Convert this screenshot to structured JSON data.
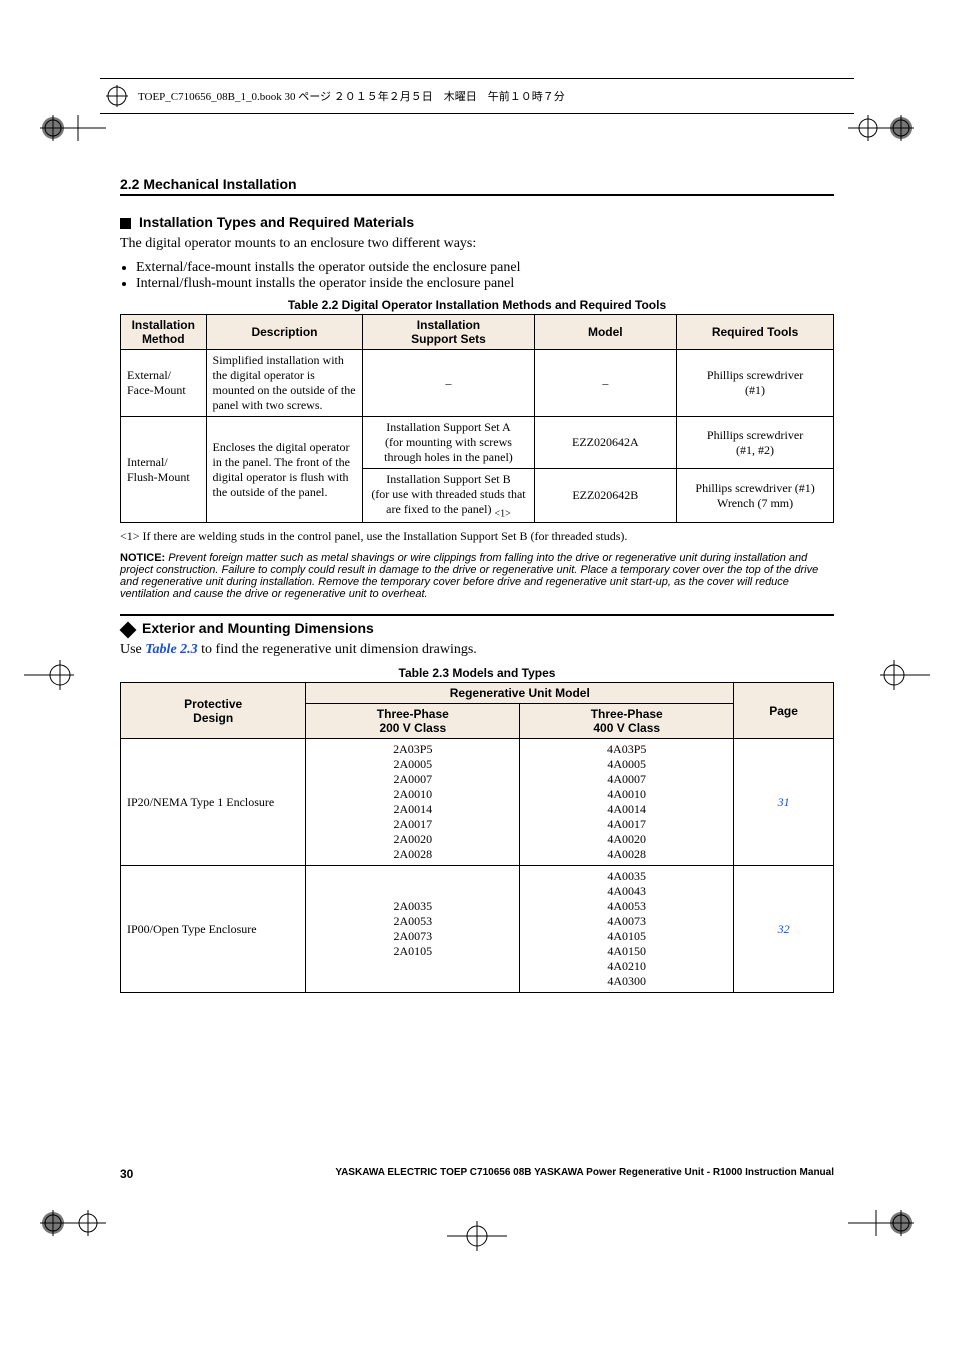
{
  "print_header": "TOEP_C710656_08B_1_0.book  30 ページ  ２０１５年２月５日　木曜日　午前１０時７分",
  "section_header": "2.2  Mechanical Installation",
  "subheading1": "Installation Types and Required Materials",
  "para1": "The digital operator mounts to an enclosure two different ways:",
  "bullet1": "External/face-mount installs the operator outside the enclosure panel",
  "bullet2": "Internal/flush-mount installs the operator inside the enclosure panel",
  "table22_caption": "Table 2.2  Digital Operator Installation Methods and Required Tools",
  "t22": {
    "h1": "Installation Method",
    "h2": "Description",
    "h3": "Installation\nSupport Sets",
    "h4": "Model",
    "h5": "Required Tools",
    "r1c1": "External/\nFace-Mount",
    "r1c2": "Simplified installation with the digital operator is mounted on the outside of the panel with two screws.",
    "r1c3": "–",
    "r1c4": "–",
    "r1c5": "Phillips screwdriver\n(#1)",
    "r2c1": "Internal/\nFlush-Mount",
    "r2c2": "Encloses the digital operator in the panel. The front of the digital operator is flush with the outside of the panel.",
    "r2ac3": "Installation Support Set A\n(for mounting with screws through holes in the panel)",
    "r2ac4": "EZZ020642A",
    "r2ac5": "Phillips screwdriver\n(#1, #2)",
    "r2bc3_a": "Installation Support Set B\n(for use with threaded studs that are fixed to the panel) ",
    "r2bc3_ref": "<1>",
    "r2bc4": "EZZ020642B",
    "r2bc5": "Phillips screwdriver (#1)\nWrench (7 mm)"
  },
  "footnote1": "<1>  If there are welding studs in the control panel, use the Installation Support Set B (for threaded studs).",
  "notice_label": "NOTICE:",
  "notice_text": " Prevent foreign matter such as metal shavings or wire clippings from falling into the drive or regenerative unit during installation and project construction. Failure to comply could result in damage to the drive or regenerative unit. Place a temporary cover over the top of the drive and regenerative unit during installation. Remove the temporary cover before drive and regenerative unit start-up, as the cover will reduce ventilation and cause the drive or regenerative unit to overheat.",
  "diamond_heading": "Exterior and Mounting Dimensions",
  "para2_a": "Use ",
  "para2_link": "Table 2.3",
  "para2_b": " to find the regenerative unit dimension drawings.",
  "table23_caption": "Table 2.3  Models and Types",
  "t23": {
    "h_design": "Protective\nDesign",
    "h_model": "Regenerative Unit Model",
    "h_200": "Three-Phase\n200 V Class",
    "h_400": "Three-Phase\n400 V Class",
    "h_page": "Page",
    "r1_design": "IP20/NEMA Type 1 Enclosure",
    "r1_200": "2A03P5\n2A0005\n2A0007\n2A0010\n2A0014\n2A0017\n2A0020\n2A0028",
    "r1_400": "4A03P5\n4A0005\n4A0007\n4A0010\n4A0014\n4A0017\n4A0020\n4A0028",
    "r1_page": "31",
    "r2_design": "IP00/Open Type Enclosure",
    "r2_200": "2A0035\n2A0053\n2A0073\n2A0105",
    "r2_400": "4A0035\n4A0043\n4A0053\n4A0073\n4A0105\n4A0150\n4A0210\n4A0300",
    "r2_page": "32"
  },
  "footer_page": "30",
  "footer_text": "YASKAWA ELECTRIC TOEP C710656 08B YASKAWA Power Regenerative Unit - R1000 Instruction Manual",
  "chart_data": [
    {
      "type": "table",
      "title": "Table 2.2 Digital Operator Installation Methods and Required Tools",
      "columns": [
        "Installation Method",
        "Description",
        "Installation Support Sets",
        "Model",
        "Required Tools"
      ],
      "rows": [
        [
          "External/Face-Mount",
          "Simplified installation with the digital operator is mounted on the outside of the panel with two screws.",
          "–",
          "–",
          "Phillips screwdriver (#1)"
        ],
        [
          "Internal/Flush-Mount",
          "Encloses the digital operator in the panel. The front of the digital operator is flush with the outside of the panel.",
          "Installation Support Set A (for mounting with screws through holes in the panel)",
          "EZZ020642A",
          "Phillips screwdriver (#1, #2)"
        ],
        [
          "Internal/Flush-Mount",
          "Encloses the digital operator in the panel. The front of the digital operator is flush with the outside of the panel.",
          "Installation Support Set B (for use with threaded studs that are fixed to the panel) <1>",
          "EZZ020642B",
          "Phillips screwdriver (#1) Wrench (7 mm)"
        ]
      ]
    },
    {
      "type": "table",
      "title": "Table 2.3 Models and Types",
      "columns": [
        "Protective Design",
        "Three-Phase 200 V Class",
        "Three-Phase 400 V Class",
        "Page"
      ],
      "rows": [
        [
          "IP20/NEMA Type 1 Enclosure",
          [
            "2A03P5",
            "2A0005",
            "2A0007",
            "2A0010",
            "2A0014",
            "2A0017",
            "2A0020",
            "2A0028"
          ],
          [
            "4A03P5",
            "4A0005",
            "4A0007",
            "4A0010",
            "4A0014",
            "4A0017",
            "4A0020",
            "4A0028"
          ],
          31
        ],
        [
          "IP00/Open Type Enclosure",
          [
            "2A0035",
            "2A0053",
            "2A0073",
            "2A0105"
          ],
          [
            "4A0035",
            "4A0043",
            "4A0053",
            "4A0073",
            "4A0105",
            "4A0150",
            "4A0210",
            "4A0300"
          ],
          32
        ]
      ]
    }
  ]
}
